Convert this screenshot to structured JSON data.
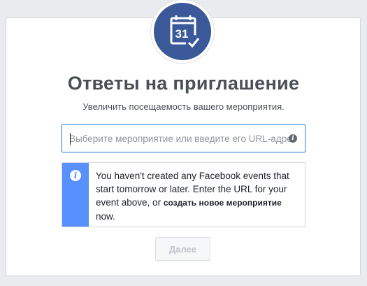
{
  "header": {
    "icon_number": "31",
    "title": "Ответы на приглашение",
    "subtitle": "Увеличить посещаемость вашего мероприятия."
  },
  "event_input": {
    "placeholder": "Выберите мероприятие или введите его URL-адрес",
    "value": ""
  },
  "notice": {
    "text_before": "You haven't created any Facebook events that start tomorrow or later. Enter the URL for your event above, or ",
    "link_label": "создать новое мероприятие",
    "text_after": " now."
  },
  "actions": {
    "next_label": "Далее"
  },
  "colors": {
    "brand": "#3b5998",
    "info_bar": "#5890ff",
    "title_text": "#4b4f56"
  }
}
